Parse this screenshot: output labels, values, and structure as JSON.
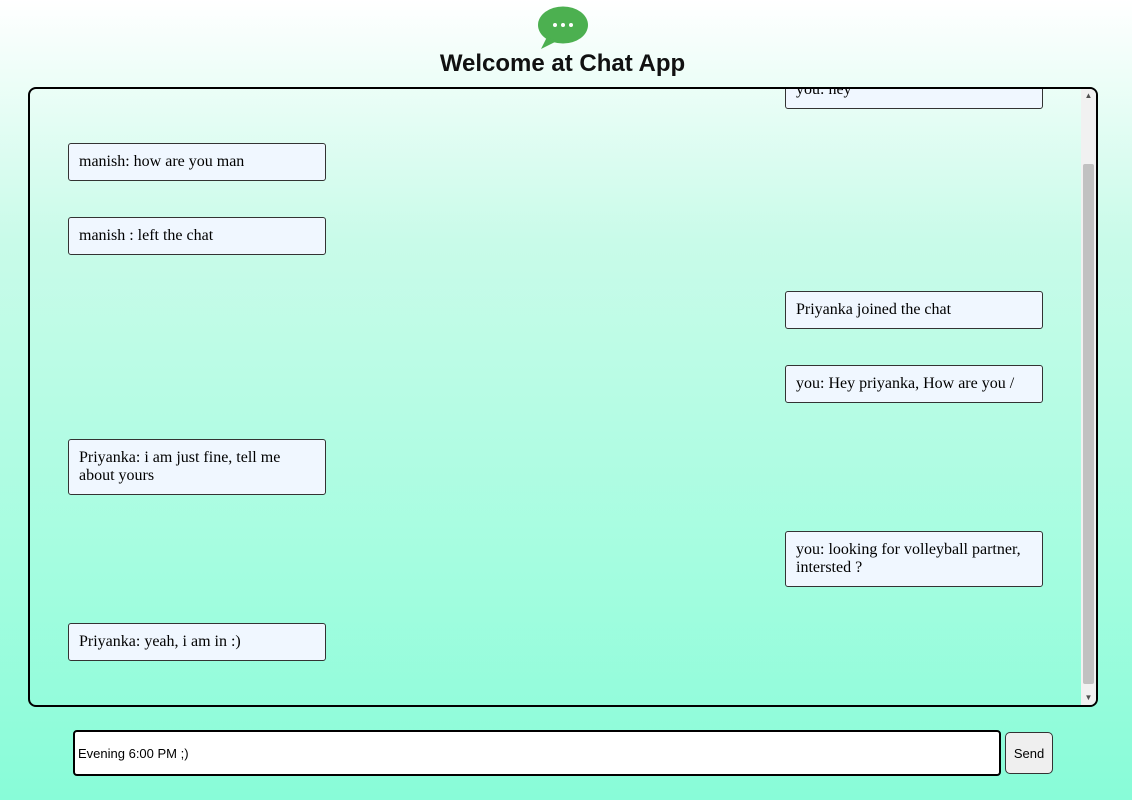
{
  "header": {
    "title": "Welcome at Chat App",
    "logo_icon": "chat-bubble-icon",
    "logo_color": "#4cb050"
  },
  "chat": {
    "messages": [
      {
        "side": "right",
        "text": "you: hey"
      },
      {
        "side": "left",
        "text": "manish: how are you man"
      },
      {
        "side": "left",
        "text": "manish : left the chat"
      },
      {
        "side": "right",
        "text": "Priyanka joined the chat"
      },
      {
        "side": "right",
        "text": "you: Hey priyanka, How are you /"
      },
      {
        "side": "left",
        "text": "Priyanka: i am just fine, tell me about yours"
      },
      {
        "side": "right",
        "text": "you: looking for volleyball partner, intersted ?"
      },
      {
        "side": "left",
        "text": "Priyanka: yeah, i am in :)"
      }
    ],
    "bubble_color": "#f0f7ff"
  },
  "composer": {
    "input_value": "Evening 6:00 PM ;)",
    "send_label": "Send"
  }
}
